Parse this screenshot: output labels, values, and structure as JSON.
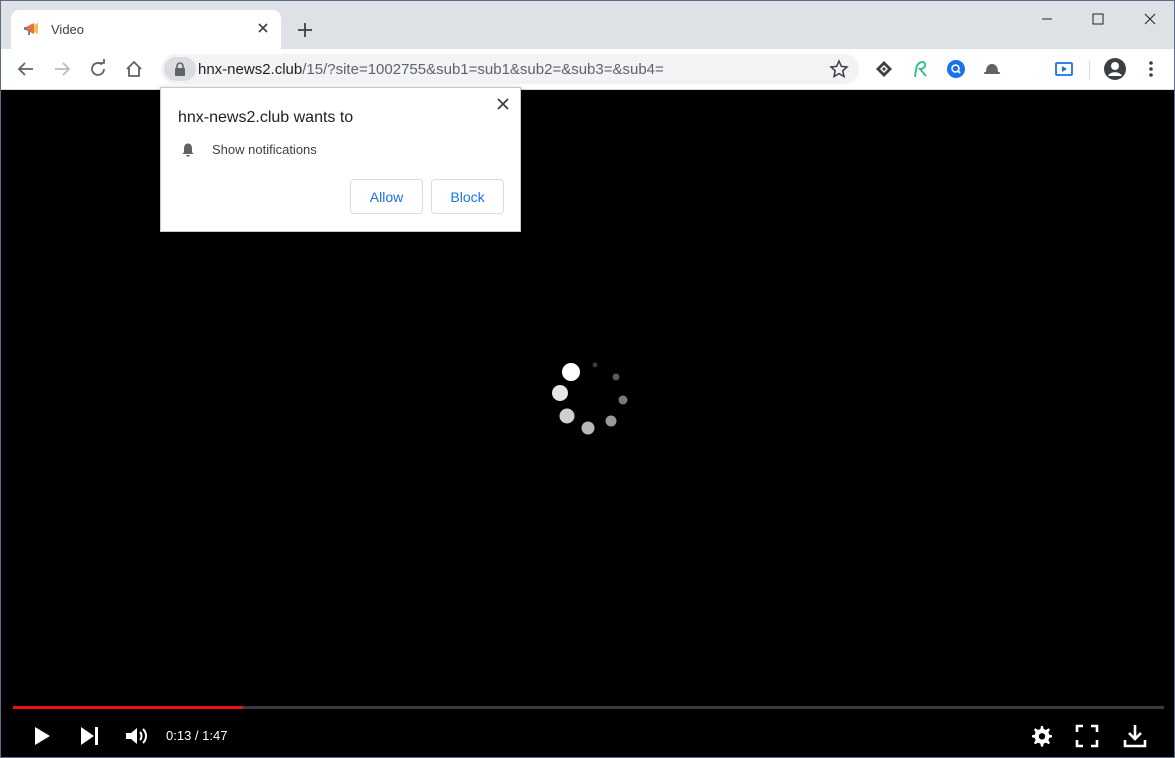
{
  "tab": {
    "title": "Video"
  },
  "address": {
    "host": "hnx-news2.club",
    "path": "/15/?site=1002755&sub1=sub1&sub2=&sub3=&sub4="
  },
  "popup": {
    "title": "hnx-news2.club wants to",
    "permission": "Show notifications",
    "allow_label": "Allow",
    "block_label": "Block"
  },
  "player": {
    "current_time": "0:13",
    "separator": " / ",
    "duration": "1:47",
    "progress_fraction": 0.2
  },
  "colors": {
    "progress": "#ee1111",
    "accent": "#1a73e8"
  }
}
